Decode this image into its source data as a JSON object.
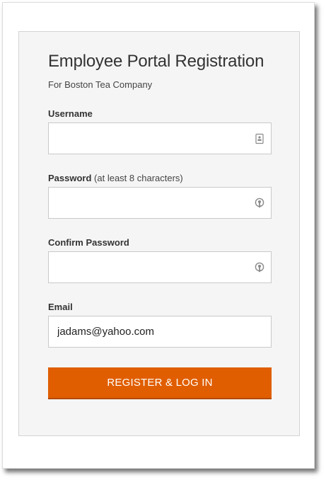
{
  "form": {
    "title": "Employee Portal Registration",
    "subtitle": "For Boston Tea Company",
    "username": {
      "label": "Username",
      "value": "",
      "icon": "contact-card-icon"
    },
    "password": {
      "label": "Password",
      "hint": "(at least 8 characters)",
      "value": "",
      "icon": "key-icon"
    },
    "confirm_password": {
      "label": "Confirm Password",
      "value": "",
      "icon": "key-icon"
    },
    "email": {
      "label": "Email",
      "value": "jadams@yahoo.com"
    },
    "submit_label": "REGISTER & LOG IN"
  },
  "colors": {
    "accent": "#e05e00",
    "card_background": "#f5f5f5",
    "field_border": "#c9c9c9"
  }
}
